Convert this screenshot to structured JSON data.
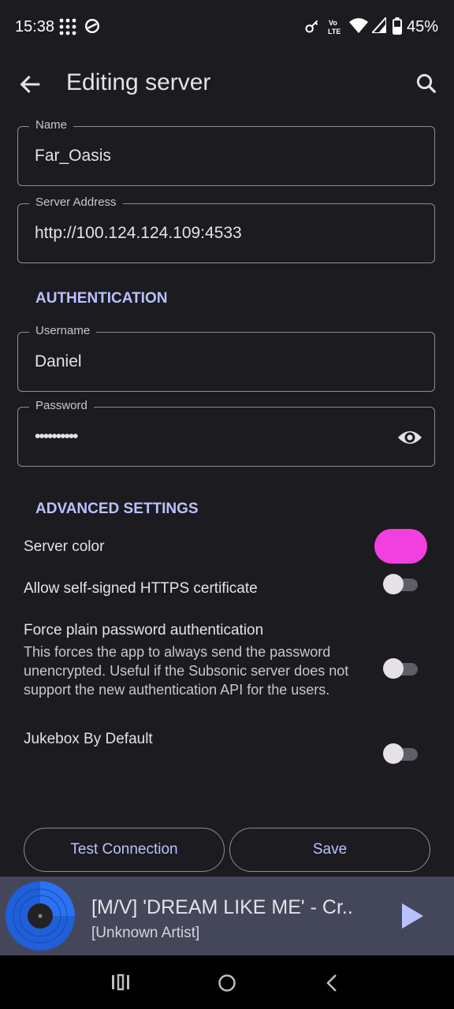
{
  "status_bar": {
    "time": "15:38",
    "battery": "45%",
    "icons": [
      "dots-grid-icon",
      "sync-icon",
      "key-icon",
      "volte-icon",
      "wifi-icon",
      "signal-icon",
      "battery-icon"
    ]
  },
  "app_bar": {
    "title": "Editing server"
  },
  "fields": {
    "name": {
      "label": "Name",
      "value": "Far_Oasis"
    },
    "server_address": {
      "label": "Server Address",
      "value": "http://100.124.124.109:4533"
    },
    "username": {
      "label": "Username",
      "value": "Daniel"
    },
    "password": {
      "label": "Password",
      "value": "••••••••••"
    }
  },
  "sections": {
    "authentication": "AUTHENTICATION",
    "advanced": "ADVANCED SETTINGS"
  },
  "settings": {
    "server_color": {
      "label": "Server color",
      "color": "#f23fe0"
    },
    "self_signed": {
      "label": "Allow self-signed HTTPS certificate",
      "enabled": false
    },
    "plain_password": {
      "label": "Force plain password authentication",
      "description": "This forces the app to always send the password unencrypted. Useful if the Subsonic server does not support the new authentication API for the users.",
      "enabled": false
    },
    "jukebox": {
      "label": "Jukebox By Default",
      "enabled": false
    }
  },
  "buttons": {
    "test_connection": "Test Connection",
    "save": "Save"
  },
  "player": {
    "title": "[M/V] 'DREAM LIKE ME' - Cr..",
    "artist": "[Unknown Artist]"
  },
  "colors": {
    "background": "#1c1b20",
    "accent": "#b8c2ff",
    "player_bg": "#44465a",
    "server_color": "#f23fe0"
  }
}
